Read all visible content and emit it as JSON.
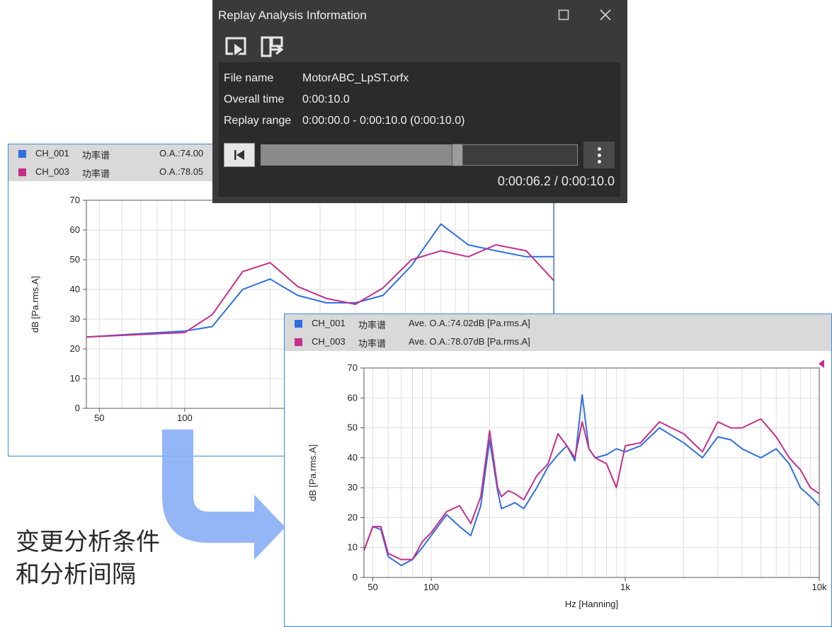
{
  "dialog": {
    "title": "Replay Analysis Information",
    "maximize_icon": "maximize-icon",
    "close_icon": "close-icon",
    "toolbar": [
      "replay-play-icon",
      "replay-export-icon"
    ],
    "info": {
      "file_label": "File name",
      "file_value": "MotorABC_LpST.orfx",
      "overall_label": "Overall time",
      "overall_value": "0:00:10.0",
      "range_label": "Replay range",
      "range_value": "0:00:00.0 - 0:00:10.0 (0:00:10.0)"
    },
    "progress": 0.62,
    "time_readout": "0:00:06.2 / 0:00:10.0"
  },
  "chart_back": {
    "legend": [
      {
        "channel": "CH_001",
        "kind": "功率谱",
        "value": "O.A.:74.00",
        "color": "#2f6fe0"
      },
      {
        "channel": "CH_003",
        "kind": "功率谱",
        "value": "O.A.:78.05",
        "color": "#c42f8a"
      }
    ]
  },
  "chart_front": {
    "legend": [
      {
        "channel": "CH_001",
        "kind": "功率谱",
        "value": "Ave.  O.A.:74.02dB [Pa.rms.A]",
        "color": "#2f6fe0"
      },
      {
        "channel": "CH_003",
        "kind": "功率谱",
        "value": "Ave.  O.A.:78.07dB [Pa.rms.A]",
        "color": "#c42f8a"
      }
    ]
  },
  "caption": {
    "line1": "变更分析条件",
    "line2": "和分析间隔"
  },
  "arrow_color": "#8aaef5",
  "chart_data": [
    {
      "type": "line",
      "title": "",
      "xlabel": "",
      "ylabel": "dB [Pa.rms.A]",
      "x_scale": "log",
      "xlim": [
        45,
        2000
      ],
      "ylim": [
        0,
        70
      ],
      "x_tick_labels": [
        "50",
        "100"
      ],
      "y_ticks": [
        0,
        10,
        20,
        30,
        40,
        50,
        60,
        70
      ],
      "grid": true,
      "series": [
        {
          "name": "CH_001",
          "color": "#2f6fe0",
          "x": [
            45,
            100,
            125,
            160,
            200,
            250,
            315,
            400,
            500,
            630,
            800,
            1000,
            1250,
            1600,
            2000
          ],
          "y": [
            24,
            26,
            27.5,
            40,
            43.5,
            38,
            35.5,
            35.5,
            38,
            48,
            62,
            55,
            53,
            51,
            51
          ]
        },
        {
          "name": "CH_003",
          "color": "#c42f8a",
          "x": [
            45,
            100,
            125,
            160,
            200,
            250,
            315,
            400,
            500,
            630,
            800,
            1000,
            1250,
            1600,
            2000
          ],
          "y": [
            24,
            25.5,
            31.5,
            46,
            49,
            41,
            37,
            35,
            40.5,
            50,
            53,
            51,
            55,
            53,
            43
          ]
        }
      ]
    },
    {
      "type": "line",
      "title": "",
      "xlabel": "Hz [Hanning]",
      "ylabel": "dB [Pa.rms.A]",
      "x_scale": "log",
      "xlim": [
        45,
        10000
      ],
      "ylim": [
        0,
        70
      ],
      "x_tick_labels": [
        "50",
        "100",
        "1k",
        "10k"
      ],
      "y_ticks": [
        0,
        10,
        20,
        30,
        40,
        50,
        60,
        70
      ],
      "grid": true,
      "series": [
        {
          "name": "CH_001",
          "color": "#2f6fe0",
          "x": [
            45,
            50,
            55,
            60,
            70,
            80,
            90,
            100,
            120,
            140,
            160,
            180,
            200,
            220,
            230,
            250,
            270,
            300,
            350,
            400,
            450,
            500,
            550,
            600,
            650,
            700,
            800,
            900,
            1000,
            1200,
            1500,
            2000,
            2500,
            3000,
            3500,
            4000,
            5000,
            6000,
            7000,
            8000,
            9000,
            10000
          ],
          "y": [
            9,
            17,
            16,
            7,
            4,
            6,
            10,
            14,
            21,
            17,
            14,
            24,
            46,
            29,
            23,
            24,
            25,
            23,
            30,
            37,
            41,
            44,
            39,
            61,
            43,
            40,
            41,
            43,
            42,
            44,
            50,
            45,
            40,
            47,
            46,
            43,
            40,
            43,
            38,
            30,
            27,
            24
          ]
        },
        {
          "name": "CH_003",
          "color": "#c42f8a",
          "x": [
            45,
            50,
            55,
            60,
            70,
            80,
            90,
            100,
            120,
            140,
            160,
            180,
            200,
            220,
            230,
            250,
            270,
            300,
            350,
            400,
            450,
            500,
            550,
            600,
            650,
            700,
            800,
            900,
            1000,
            1200,
            1500,
            2000,
            2500,
            3000,
            3500,
            4000,
            5000,
            6000,
            7000,
            8000,
            9000,
            10000
          ],
          "y": [
            9,
            17,
            17,
            8,
            6,
            6,
            12,
            15,
            22,
            24,
            18,
            27,
            49,
            30,
            27,
            29,
            28,
            26,
            34,
            38,
            48,
            44,
            40,
            52,
            43,
            40,
            38,
            30,
            44,
            45,
            52,
            48,
            42,
            52,
            50,
            50,
            53,
            47,
            40,
            36,
            30,
            28
          ]
        }
      ]
    }
  ]
}
